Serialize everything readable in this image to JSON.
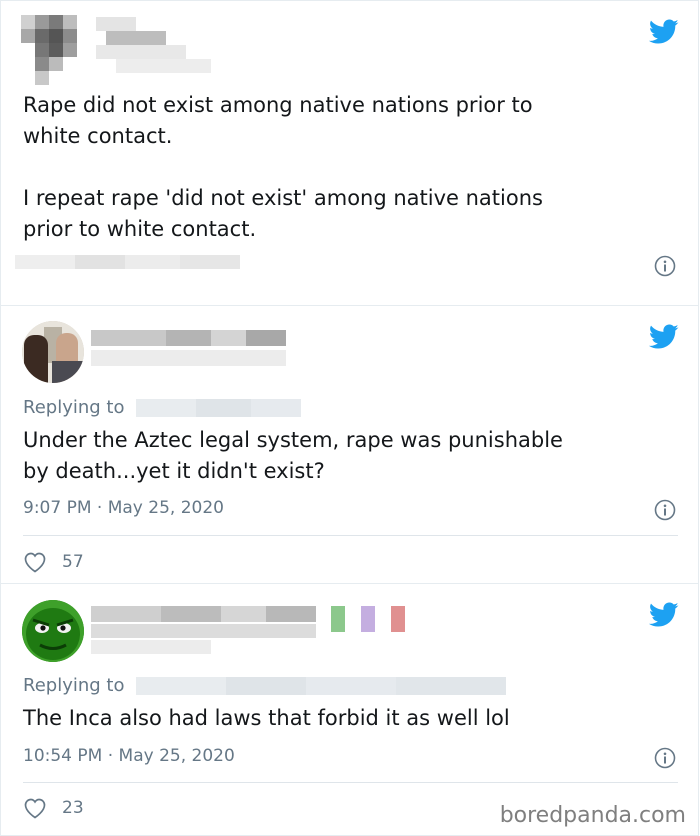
{
  "tweets": [
    {
      "text": "Rape did not exist among native nations prior to\nwhite contact.\n\nI repeat rape 'did not exist' among native nations\nprior to white contact."
    },
    {
      "replying_label": "Replying to",
      "text": "Under the Aztec legal system, rape was punishable\nby death...yet it didn't exist?",
      "timestamp": "9:07 PM · May 25, 2020",
      "likes": "57"
    },
    {
      "replying_label": "Replying to",
      "text": "The Inca also had laws that forbid it as well lol",
      "timestamp": "10:54 PM · May 25, 2020",
      "likes": "23"
    }
  ],
  "watermark": "boredpanda.com",
  "colors": {
    "twitter_blue": "#1da1f2",
    "meta_gray": "#657786",
    "border": "#e6ecf0"
  },
  "icons": [
    "twitter-bird-icon",
    "info-icon",
    "heart-icon"
  ]
}
